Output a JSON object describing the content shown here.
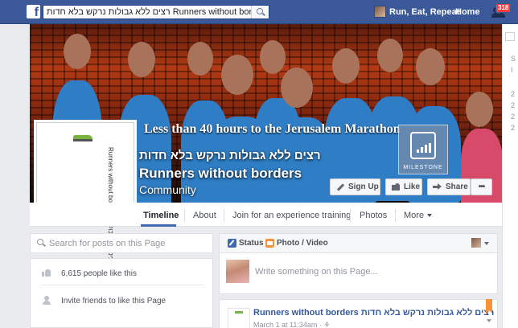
{
  "topbar": {
    "logo": "f",
    "search_value": "רצים ללא גבולות נרקש בלא חדות Runners without borders",
    "user_name": "Run, Eat, Repeat",
    "home_label": "Home",
    "notification_count": "318"
  },
  "cover": {
    "headline": "Less than 40 hours to the Jerusalem Marathon",
    "milestone_label": "MILESTONE",
    "page_name_hebrew": "רצים ללא גבולות נרקש בלא חדות",
    "page_name": "Runners without borders",
    "category": "Community",
    "buttons": {
      "signup": "Sign Up",
      "like": "Like",
      "share": "Share",
      "more": "•••"
    }
  },
  "profile": {
    "logo_text": "Runners without borders רצים ללא גבולות"
  },
  "tabs": [
    "Timeline",
    "About",
    "Join for an experience training",
    "Photos",
    "More"
  ],
  "left": {
    "search_placeholder": "Search for posts on this Page",
    "likes_text": "6,615 people like this",
    "invite_text": "Invite friends to like this Page"
  },
  "composer": {
    "status_tab": "Status",
    "photo_tab": "Photo / Video",
    "placeholder": "Write something on this Page..."
  },
  "post": {
    "title": "Runners without borders רצים ללא גבולות נרקש בלא חדות",
    "meta": "March 1 at 11:34am · ⚘"
  },
  "colors": {
    "brand": "#3b5998",
    "badge": "#fa3e3e",
    "accent": "#4267b2"
  }
}
